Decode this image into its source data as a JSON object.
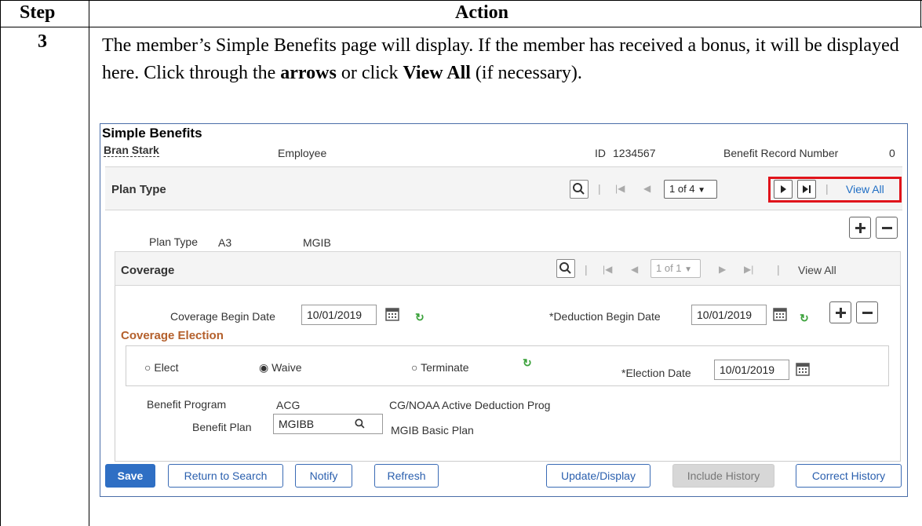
{
  "table": {
    "header_step": "Step",
    "header_action": "Action",
    "step_number": "3"
  },
  "instruction": {
    "part1": "The member’s Simple Benefits page will display. If the member has received a bonus, it will be displayed here. Click through the ",
    "bold1": "arrows",
    "part2": " or click ",
    "bold2": "View All",
    "part3": " (if necessary)."
  },
  "page": {
    "title": "Simple Benefits",
    "employee_name": "Bran Stark",
    "employee_label": "Employee",
    "id_label": "ID",
    "id_value": "1234567",
    "benefit_record_label": "Benefit Record Number",
    "benefit_record_value": "0"
  },
  "plan_type_bar": {
    "label": "Plan Type",
    "pager": "1 of 4",
    "view_all": "View All"
  },
  "plan_type_row": {
    "label": "Plan Type",
    "code": "A3",
    "description": "MGIB"
  },
  "coverage_bar": {
    "label": "Coverage",
    "pager": "1 of 1",
    "view_all": "View All"
  },
  "coverage": {
    "begin_date_label": "Coverage Begin Date",
    "begin_date_value": "10/01/2019",
    "deduction_date_label": "*Deduction Begin Date",
    "deduction_date_value": "10/01/2019",
    "election_title": "Coverage Election",
    "radio_elect": "Elect",
    "radio_waive": "Waive",
    "radio_terminate": "Terminate",
    "election_date_label": "*Election Date",
    "election_date_value": "10/01/2019",
    "benefit_program_label": "Benefit Program",
    "benefit_program_code": "ACG",
    "benefit_program_desc": "CG/NOAA Active Deduction Prog",
    "benefit_plan_label": "Benefit Plan",
    "benefit_plan_value": "MGIBB",
    "benefit_plan_desc": "MGIB Basic Plan"
  },
  "buttons": {
    "save": "Save",
    "return_to_search": "Return to Search",
    "notify": "Notify",
    "refresh": "Refresh",
    "update_display": "Update/Display",
    "include_history": "Include History",
    "correct_history": "Correct History"
  },
  "colors": {
    "highlight": "#e0141b",
    "primary_button": "#2f6fc4",
    "section_title": "#b4602c",
    "link": "#1f6ec4"
  }
}
